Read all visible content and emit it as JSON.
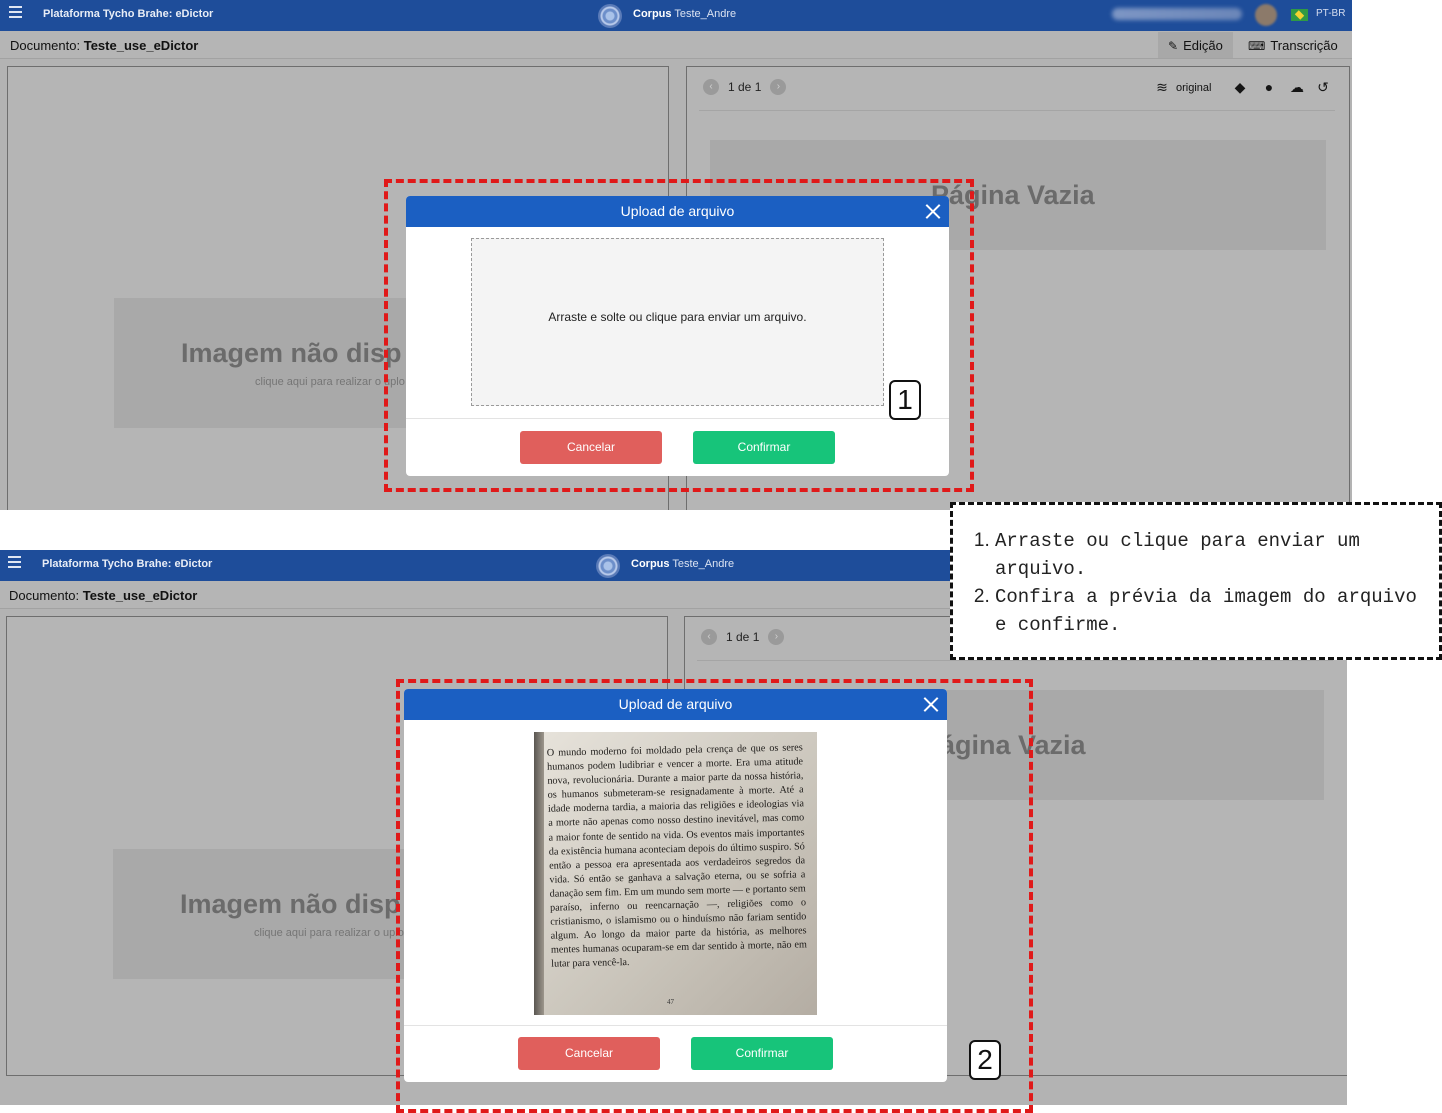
{
  "app": {
    "brand": "Plataforma Tycho Brahe: eDictor",
    "corpus_label": "Corpus",
    "corpus_name": "Teste_Andre",
    "lang": "PT-BR",
    "menu_icon": "hamburger-icon",
    "flag_icon": "brazil-flag-icon"
  },
  "document": {
    "label": "Documento:",
    "name": "Teste_use_eDictor"
  },
  "tabs": [
    {
      "label": "Edição",
      "icon": "edit-icon",
      "active": true
    },
    {
      "label": "Transcrição",
      "icon": "keyboard-icon",
      "active": false
    }
  ],
  "left_pane": {
    "title": "Imagem não disp",
    "subtitle": "clique aqui para realizar o uplo"
  },
  "right_pane": {
    "pager": "1 de 1",
    "view_label": "original",
    "empty_title": "Página Vazia",
    "empty_title_partial": "ágina Vazia",
    "tools": [
      "layers-icon",
      "tags-icon",
      "info-icon",
      "comments-icon",
      "undo-icon"
    ]
  },
  "modal": {
    "title": "Upload de arquivo",
    "dropzone_text": "Arraste e solte ou clique para enviar um arquivo.",
    "cancel_label": "Cancelar",
    "confirm_label": "Confirmar",
    "preview_text": "O mundo moderno foi moldado pela crença de que os seres humanos podem ludibriar e vencer a morte. Era uma atitude nova, revolucionária. Durante a maior parte da nossa história, os humanos submeteram-se resignadamente à morte. Até a idade moderna tardia, a maioria das religiões e ideologias via a morte não apenas como nosso destino inevitável, mas como a maior fonte de sentido na vida. Os eventos mais importantes da existência humana aconteciam depois do último suspiro. Só então a pessoa era apresentada aos verdadeiros segredos da vida. Só então se ganhava a salvação eterna, ou se sofria a danação sem fim. Em um mundo sem morte — e portanto sem paraíso, inferno ou reencarnação —, religiões como o cristianismo, o islamismo ou o hinduísmo não fariam sentido algum. Ao longo da maior parte da história, as melhores mentes humanas ocuparam-se em dar sentido à morte, não em lutar para vencê-la.",
    "preview_page": "47"
  },
  "steps": [
    "1",
    "2"
  ],
  "instructions": [
    "Arraste ou clique para enviar um arquivo.",
    "Confira a prévia da imagem do arquivo e confirme."
  ],
  "colors": {
    "appbar": "#1e4d9a",
    "modal_header": "#1b5fc2",
    "cancel": "#e05f5c",
    "confirm": "#17c47a",
    "highlight": "#e01919"
  }
}
